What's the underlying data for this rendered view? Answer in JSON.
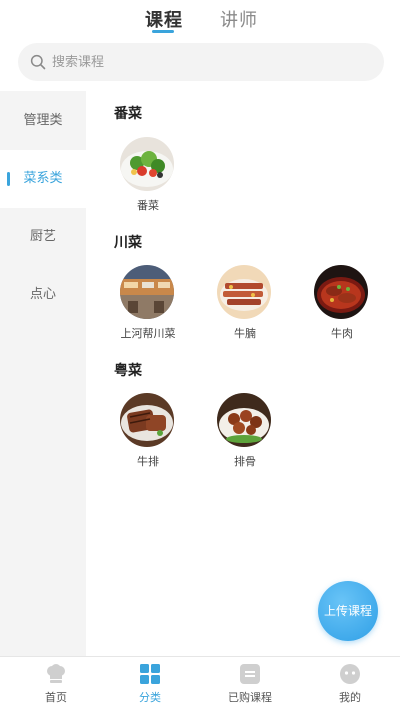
{
  "top_tabs": {
    "courses": "课程",
    "lecturers": "讲师"
  },
  "search": {
    "placeholder": "搜索课程"
  },
  "sidebar": {
    "items": [
      {
        "label": "管理类"
      },
      {
        "label": "菜系类"
      },
      {
        "label": "厨艺"
      },
      {
        "label": "点心"
      }
    ]
  },
  "sections": [
    {
      "title": "番菜",
      "courses": [
        {
          "label": "番菜"
        }
      ]
    },
    {
      "title": "川菜",
      "courses": [
        {
          "label": "上河帮川菜"
        },
        {
          "label": "牛腩"
        },
        {
          "label": "牛肉"
        }
      ]
    },
    {
      "title": "粤菜",
      "courses": [
        {
          "label": "牛排"
        },
        {
          "label": "排骨"
        }
      ]
    }
  ],
  "upload_button": {
    "label": "上传课程"
  },
  "bottom_nav": {
    "items": [
      {
        "label": "首页",
        "icon": "chef-hat-icon"
      },
      {
        "label": "分类",
        "icon": "grid-icon"
      },
      {
        "label": "已购课程",
        "icon": "purchased-icon"
      },
      {
        "label": "我的",
        "icon": "profile-icon"
      }
    ]
  },
  "colors": {
    "accent": "#3aa4dc",
    "inactive_icon": "#cfcfcf"
  }
}
